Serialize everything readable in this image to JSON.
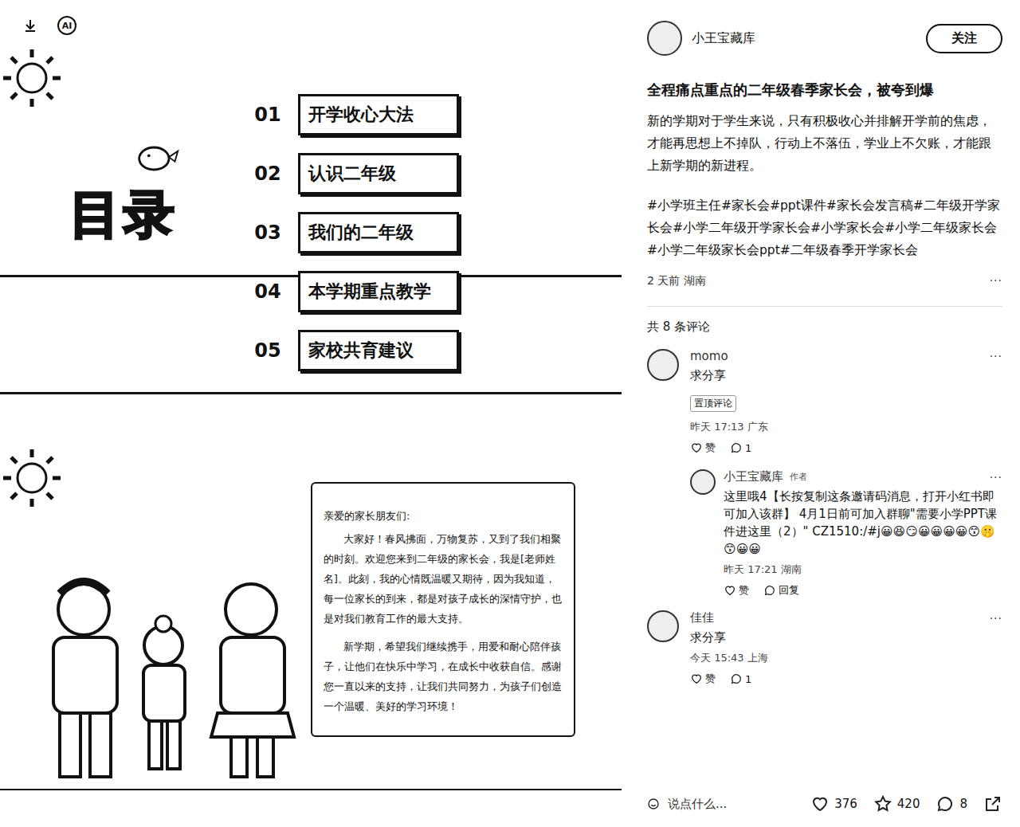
{
  "image_toolbar": {
    "ai_label": "AI"
  },
  "slides": [
    {
      "kind": "toc",
      "title": "目录",
      "items": [
        {
          "number": "01",
          "label": "开学收心大法"
        },
        {
          "number": "02",
          "label": "认识二年级"
        },
        {
          "number": "03",
          "label": "我们的二年级"
        },
        {
          "number": "04",
          "label": "本学期重点教学"
        },
        {
          "number": "05",
          "label": "家校共育建议"
        }
      ]
    },
    {
      "kind": "letter",
      "greeting": "亲爱的家长朋友们:",
      "paragraphs": [
        "大家好！春风拂面，万物复苏，又到了我们相聚的时刻。欢迎您来到二年级的家长会，我是[老师姓名]。此刻，我的心情既温暖又期待，因为我知道，每一位家长的到来，都是对孩子成长的深情守护，也是对我们教育工作的最大支持。",
        "新学期，希望我们继续携手，用爱和耐心陪伴孩子，让他们在快乐中学习，在成长中收获自信。感谢您一直以来的支持，让我们共同努力，为孩子们创造一个温暖、美好的学习环境！"
      ]
    }
  ],
  "author": {
    "name": "小王宝藏库",
    "follow": "关注"
  },
  "post": {
    "title": "全程痛点重点的二年级春季家长会，被夸到爆",
    "body": "新的学期对于学生来说，只有积极收心并排解开学前的焦虑，才能再思想上不掉队，行动上不落伍，学业上不欠账，才能跟上新学期的新进程。",
    "tags": [
      "#小学班主任",
      "#家长会",
      "#ppt课件",
      "#家长会发言稿",
      "#二年级开学家长会",
      "#小学二年级开学家长会",
      "#小学家长会",
      "#小学二年级家长会",
      "#小学二年级家长会ppt",
      "#二年级春季开学家长会"
    ],
    "meta": "2 天前 湖南",
    "more": "···"
  },
  "comments_count": "共 8 条评论",
  "comments": [
    {
      "name": "momo",
      "text": "求分享",
      "badge": "置顶评论",
      "time": "昨天 17:13 广东",
      "like": "赞",
      "reply": "1",
      "more": "···",
      "replies": [
        {
          "name": "小王宝藏库",
          "tag": "作者",
          "text": "这里哦4【长按复制这条邀请码消息，打开小红书即可加入该群】 4月1日前可加入群聊\"需要小学PPT课件进这里（2）\" CZ1510:/#j😀😆😏😀😀😀😀😙🤫😙😀😀",
          "time": "昨天 17:21 湖南",
          "like": "赞",
          "reply": "回复",
          "more": "···"
        }
      ]
    },
    {
      "name": "佳佳",
      "text": "求分享",
      "badge": "",
      "time": "今天 15:43 上海",
      "like": "赞",
      "reply": "1",
      "more": "···",
      "replies": []
    }
  ],
  "bottom_bar": {
    "placeholder": "说点什么...",
    "likes": "376",
    "stars": "420",
    "comments": "8"
  }
}
